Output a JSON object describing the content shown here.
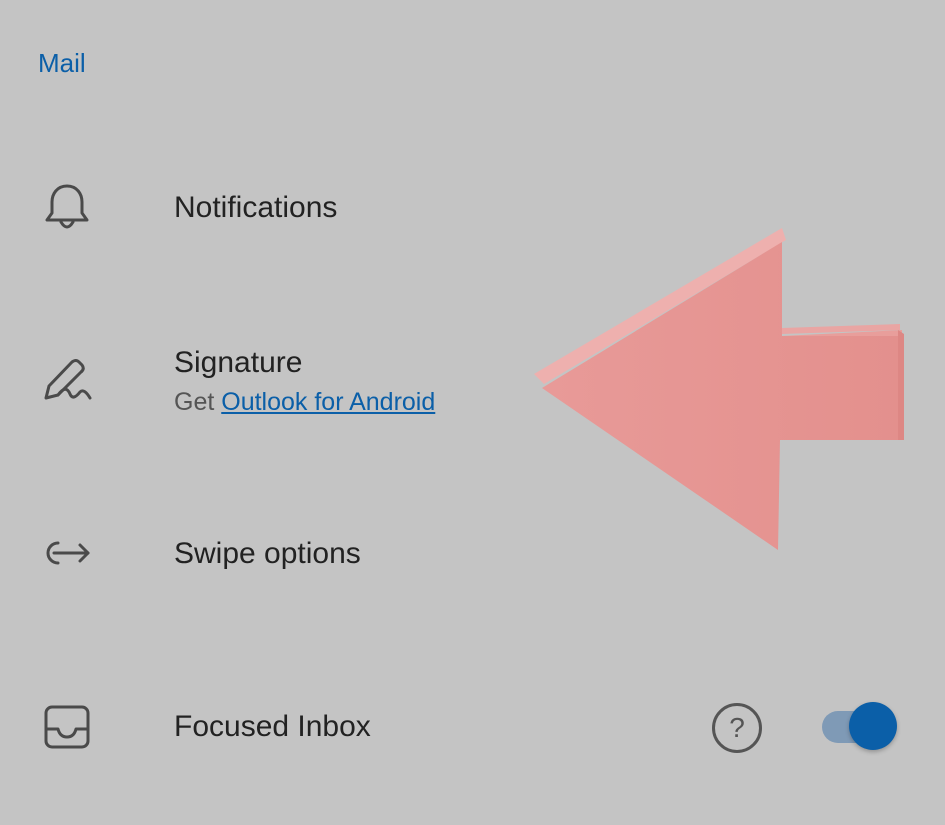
{
  "section": {
    "title": "Mail"
  },
  "items": [
    {
      "label": "Notifications",
      "icon": "bell-icon"
    },
    {
      "label": "Signature",
      "icon": "signature-pen-icon",
      "subtitle_prefix": "Get",
      "subtitle_link": "Outlook for Android"
    },
    {
      "label": "Swipe options",
      "icon": "swipe-arrow-icon"
    },
    {
      "label": "Focused Inbox",
      "icon": "inbox-tray-icon",
      "help_glyph": "?",
      "toggle_on": true
    }
  ],
  "colors": {
    "background": "#c4c4c4",
    "accent": "#0b5fa8",
    "arrow": "#e5918f"
  }
}
